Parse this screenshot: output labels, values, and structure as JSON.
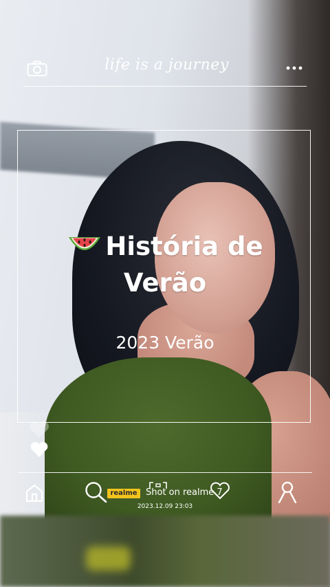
{
  "header": {
    "script_title": "life is a journey",
    "camera_icon": "camera-icon",
    "menu_icon": "more-dots-icon"
  },
  "headline": {
    "emoji_icon": "watermelon-icon",
    "line1": "História de",
    "line2": "Verão",
    "subtitle": "2023 Verão"
  },
  "side": {
    "like_icon": "heart-icon"
  },
  "footer": {
    "home_icon": "home-icon",
    "search_icon": "search-icon",
    "badge": "realme",
    "shot_text": "Shot on realme 7",
    "favorite_icon": "heart-outline-icon",
    "profile_icon": "person-icon",
    "timestamp": "2023.12.09 23:03"
  },
  "colors": {
    "badge": "#f3c31d",
    "overlay_text": "#ffffff"
  }
}
